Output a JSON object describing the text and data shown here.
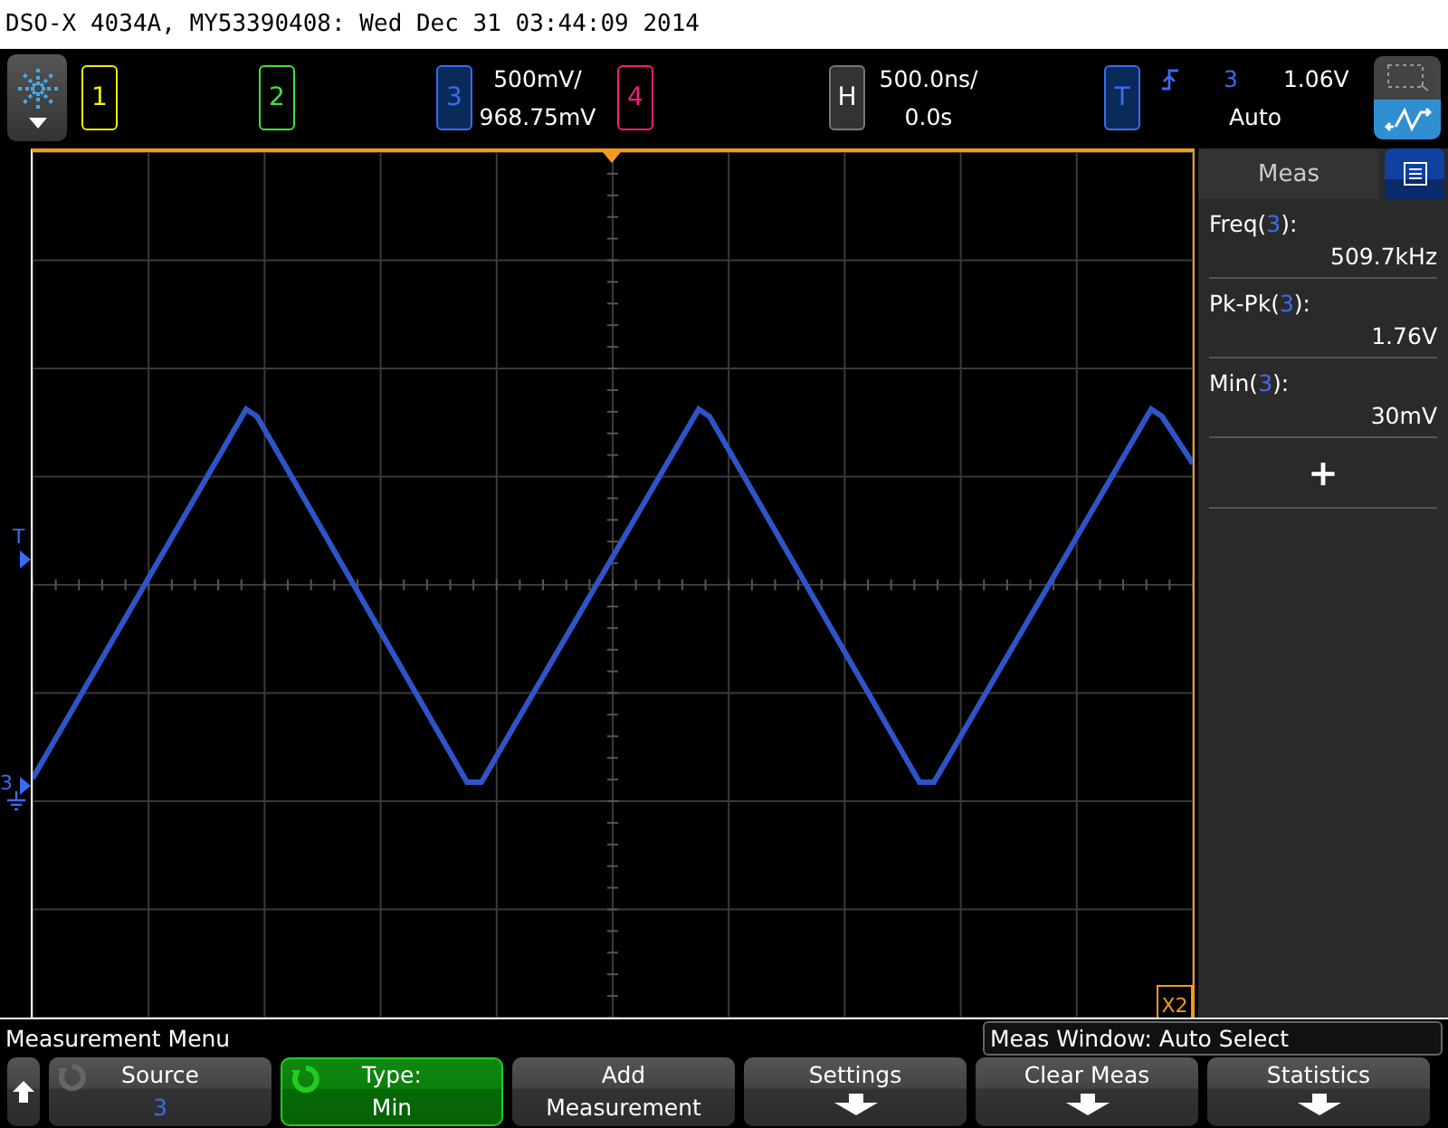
{
  "title": "DSO-X 4034A, MY53390408: Wed Dec 31 03:44:09 2014",
  "channels": [
    {
      "label": "1",
      "color": "#f0f000",
      "on": false
    },
    {
      "label": "2",
      "color": "#40e040",
      "on": false
    },
    {
      "label": "3",
      "color": "#3a6cf0",
      "on": true,
      "scale": "500mV/",
      "offset": "968.75mV"
    },
    {
      "label": "4",
      "color": "#f0207a",
      "on": false
    }
  ],
  "horizontal": {
    "label": "H",
    "scale": "500.0ns/",
    "delay": "0.0s"
  },
  "trigger": {
    "label": "T",
    "source": "3",
    "level": "1.06V",
    "mode": "Auto"
  },
  "markers": {
    "trigger": "T",
    "channel": "3",
    "cursor": "X2"
  },
  "meas_panel": {
    "title": "Meas",
    "add": "+",
    "measurements": [
      {
        "name": "Freq(",
        "source": "3",
        "close": "):",
        "value": "509.7kHz"
      },
      {
        "name": "Pk-Pk(",
        "source": "3",
        "close": "):",
        "value": "1.76V"
      },
      {
        "name": "Min(",
        "source": "3",
        "close": "):",
        "value": "30mV"
      }
    ]
  },
  "menu_title": "Measurement Menu",
  "meas_window": "Meas Window: Auto Select",
  "softkeys": [
    {
      "kind": "up"
    },
    {
      "kind": "value",
      "label": "Source",
      "value": "3",
      "selected": false
    },
    {
      "kind": "value",
      "label": "Type:",
      "value": "Min",
      "selected": true
    },
    {
      "kind": "text",
      "label": "Add",
      "value": "Measurement"
    },
    {
      "kind": "submenu",
      "label": "Settings"
    },
    {
      "kind": "submenu",
      "label": "Clear Meas"
    },
    {
      "kind": "submenu",
      "label": "Statistics"
    }
  ]
}
